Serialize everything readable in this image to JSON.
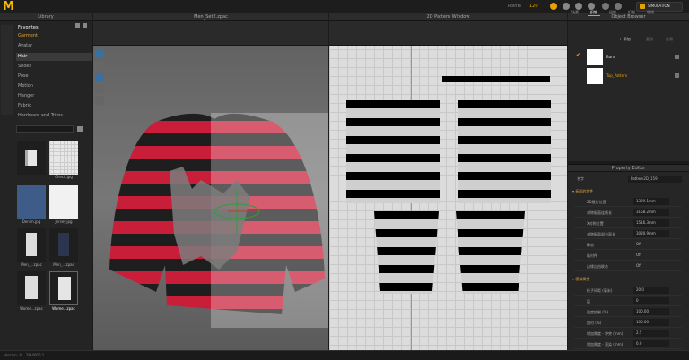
{
  "app": {
    "logo": "M",
    "points_label": "Points",
    "points_value": "120",
    "simulation_label": "SIMULATION"
  },
  "library": {
    "title": "Library",
    "nav": [
      "Favorites",
      "Garment",
      "Avatar",
      "Hair",
      "Shoes",
      "Pose",
      "Motion",
      "Hanger",
      "Fabric",
      "Hardware and Trims"
    ],
    "items": [
      {
        "label": ""
      },
      {
        "label": "Check.jpg"
      },
      {
        "label": "Denim.jpg"
      },
      {
        "label": "Jersey.jpg"
      },
      {
        "label": "Men_...zpac"
      },
      {
        "label": "Men_...zpac"
      },
      {
        "label": "Wome...zpac"
      },
      {
        "label": "Wome...zpac"
      }
    ]
  },
  "viewport": {
    "title": "Men_Set2.zpac"
  },
  "pattern": {
    "title": "2D Pattern Window"
  },
  "object_browser": {
    "title": "Object Browser",
    "tabs": [
      "场景",
      "织物",
      "纽扣",
      "扣眼",
      "明线"
    ],
    "add_label": "+ 添加",
    "copy_label": "复制",
    "apply_label": "应用",
    "items": [
      {
        "name": "Band"
      },
      {
        "name": "Top_Pattern"
      }
    ]
  },
  "property_editor": {
    "title": "Property Editor",
    "name_label": "名字",
    "name_value": "Pattern2D_159",
    "section1": "▾ 板面的特性",
    "rows1": [
      {
        "label": "2D板片位置",
        "value": "1329.1mm"
      },
      {
        "label": "对称板面连线长",
        "value": "3158.2mm"
      },
      {
        "label": "X对称位置",
        "value": "1516.3mm"
      },
      {
        "label": "对称板面部分面长",
        "value": "3030.9mm"
      },
      {
        "label": "静态",
        "value": "Off"
      },
      {
        "label": "粘衬件",
        "value": "Off"
      },
      {
        "label": "边缘自由联合",
        "value": "Off"
      }
    ],
    "section2": "▾ 模拟属性",
    "rows2": [
      {
        "label": "粒子间距 (毫米)",
        "value": "20.0"
      },
      {
        "label": "层",
        "value": "0"
      },
      {
        "label": "强度控制 (%)",
        "value": "100.00"
      },
      {
        "label": "加衬 (%)",
        "value": "100.00"
      },
      {
        "label": "增加厚度 - 冲突 (mm)",
        "value": "2.5"
      },
      {
        "label": "增加厚度 - 渲染 (mm)",
        "value": "0.0"
      }
    ]
  },
  "status": {
    "text": "Version: 4... 39 4000 1"
  }
}
